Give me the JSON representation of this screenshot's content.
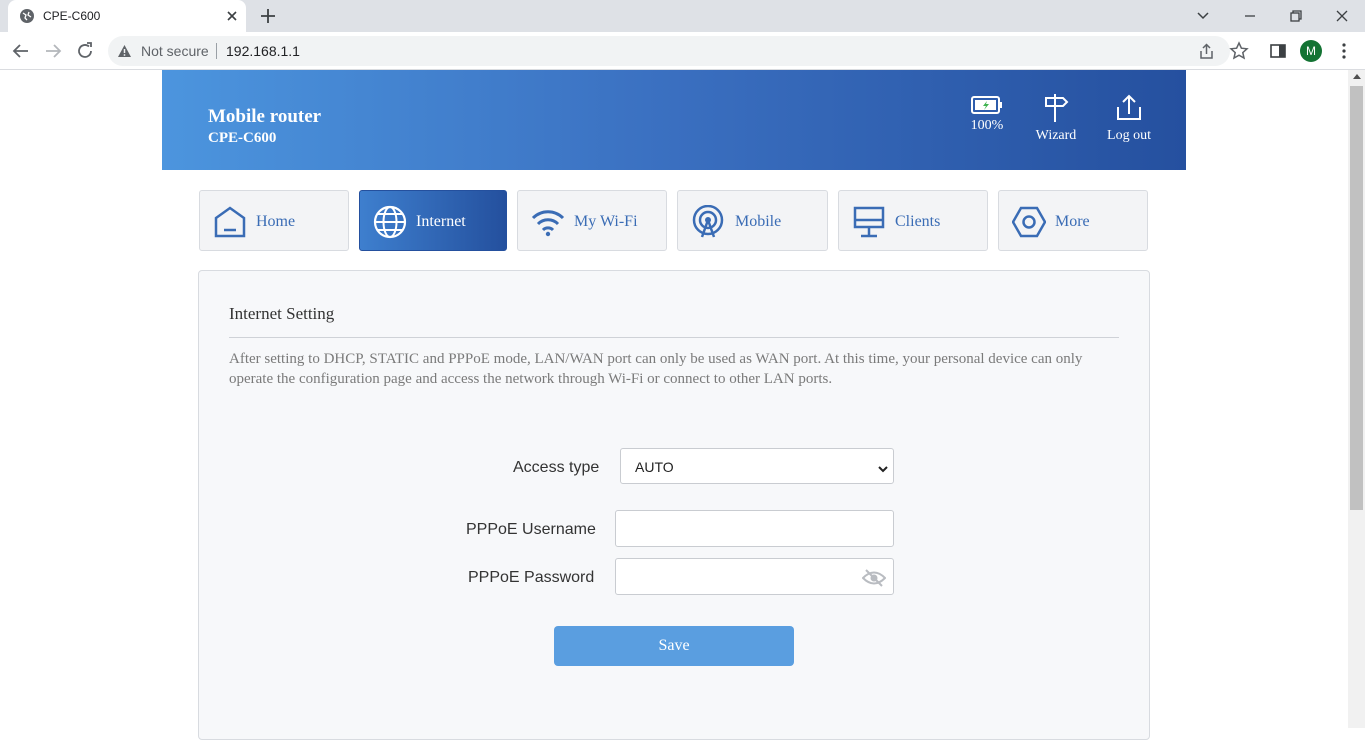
{
  "browser": {
    "tab_title": "CPE-C600",
    "security_label": "Not secure",
    "url": "192.168.1.1",
    "profile_initial": "M"
  },
  "header": {
    "title": "Mobile router",
    "model": "CPE-C600",
    "battery_label": "100%",
    "wizard_label": "Wizard",
    "logout_label": "Log out"
  },
  "nav": {
    "items": [
      {
        "label": "Home",
        "icon": "home-icon"
      },
      {
        "label": "Internet",
        "icon": "globe-icon",
        "active": true
      },
      {
        "label": "My Wi-Fi",
        "icon": "wifi-icon"
      },
      {
        "label": "Mobile",
        "icon": "antenna-icon"
      },
      {
        "label": "Clients",
        "icon": "monitor-icon"
      },
      {
        "label": "More",
        "icon": "hexagon-icon"
      }
    ]
  },
  "panel": {
    "title": "Internet Setting",
    "description": "After setting to DHCP, STATIC and PPPoE mode, LAN/WAN port can only be used as WAN port. At this time, your personal device can only operate the configuration page and access the network through Wi-Fi or connect to other LAN ports."
  },
  "form": {
    "access_type_label": "Access type",
    "access_type_value": "AUTO",
    "username_label": "PPPoE Username",
    "username_value": "",
    "password_label": "PPPoE Password",
    "password_value": "",
    "save_label": "Save"
  },
  "colors": {
    "accent": "#3a6cb5",
    "banner_start": "#4c95de",
    "banner_end": "#25509f",
    "save_button": "#5a9ee0"
  }
}
